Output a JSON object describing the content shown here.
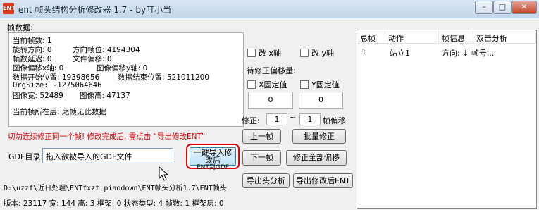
{
  "window": {
    "icon_text": "ENT",
    "title": "ent 帧头结构分析修改器 1.7  - by叮小当",
    "minimize": "–",
    "maximize": "□",
    "close": "✕"
  },
  "frame_section_label": "帧数据:",
  "frame_info": {
    "current_frame": "当前帧数: 1",
    "rotation": "旋转方向: 0",
    "direction_pos": "方向帧位: 4194304",
    "frame_delay": "帧数延迟: 0",
    "file_offset": "文件偏移: 0",
    "image_offset_x": "图像偏移x轴: 0",
    "image_offset_y": "图像偏移y轴: 0",
    "data_start": "数据开始位置: 19398656",
    "data_end": "数据结束位置: 521011200",
    "orgsize": "OrgSize: -1275064646",
    "image_width": "图像宽: 52489",
    "image_height": "图像高: 47137",
    "current_layer": "当前帧所在层: 尾帧无此数据"
  },
  "checkboxes": {
    "flip_x": "改 x轴",
    "flip_y": "改 y轴",
    "fix_x": "X固定值",
    "fix_y": "Y固定值"
  },
  "pending_label": "待修正偏移量:",
  "fix_x_value": "0",
  "fix_y_value": "0",
  "correction": {
    "label": "修正:",
    "from": "1",
    "tilde": "~",
    "to": "1",
    "suffix": "帧偏移"
  },
  "buttons": {
    "prev_frame": "上一帧",
    "batch_fix": "批量修正",
    "next_frame": "下一帧",
    "fix_all": "修正全部偏移",
    "import_line1": "一键导入修改后",
    "import_line2": "ENT到GDF",
    "export_header": "导出头分析",
    "export_modified": "导出修改后ENT"
  },
  "warning": "切勿连续修正同一个帧! 修改完成后, 需点击 “导出修改ENT”",
  "gdf": {
    "label": "GDF目录:",
    "value": "拖入欲被导入的GDF文件"
  },
  "path": "D:\\uzzf\\近日处理\\ENTfxzt_piaodown\\ENT帧头分析1.7\\ENT帧头",
  "status_bar": "版本: 23117 宽: 144 高: 3 框架: 0 状态类型: 4 帧数: 1 框架层: 0",
  "table": {
    "headers": [
      "总帧",
      "动作",
      "帧信息",
      "双击分析"
    ],
    "rows": [
      {
        "total": "1",
        "action": "站立1",
        "frame_info": "方向: ↓  帧号..."
      }
    ]
  }
}
